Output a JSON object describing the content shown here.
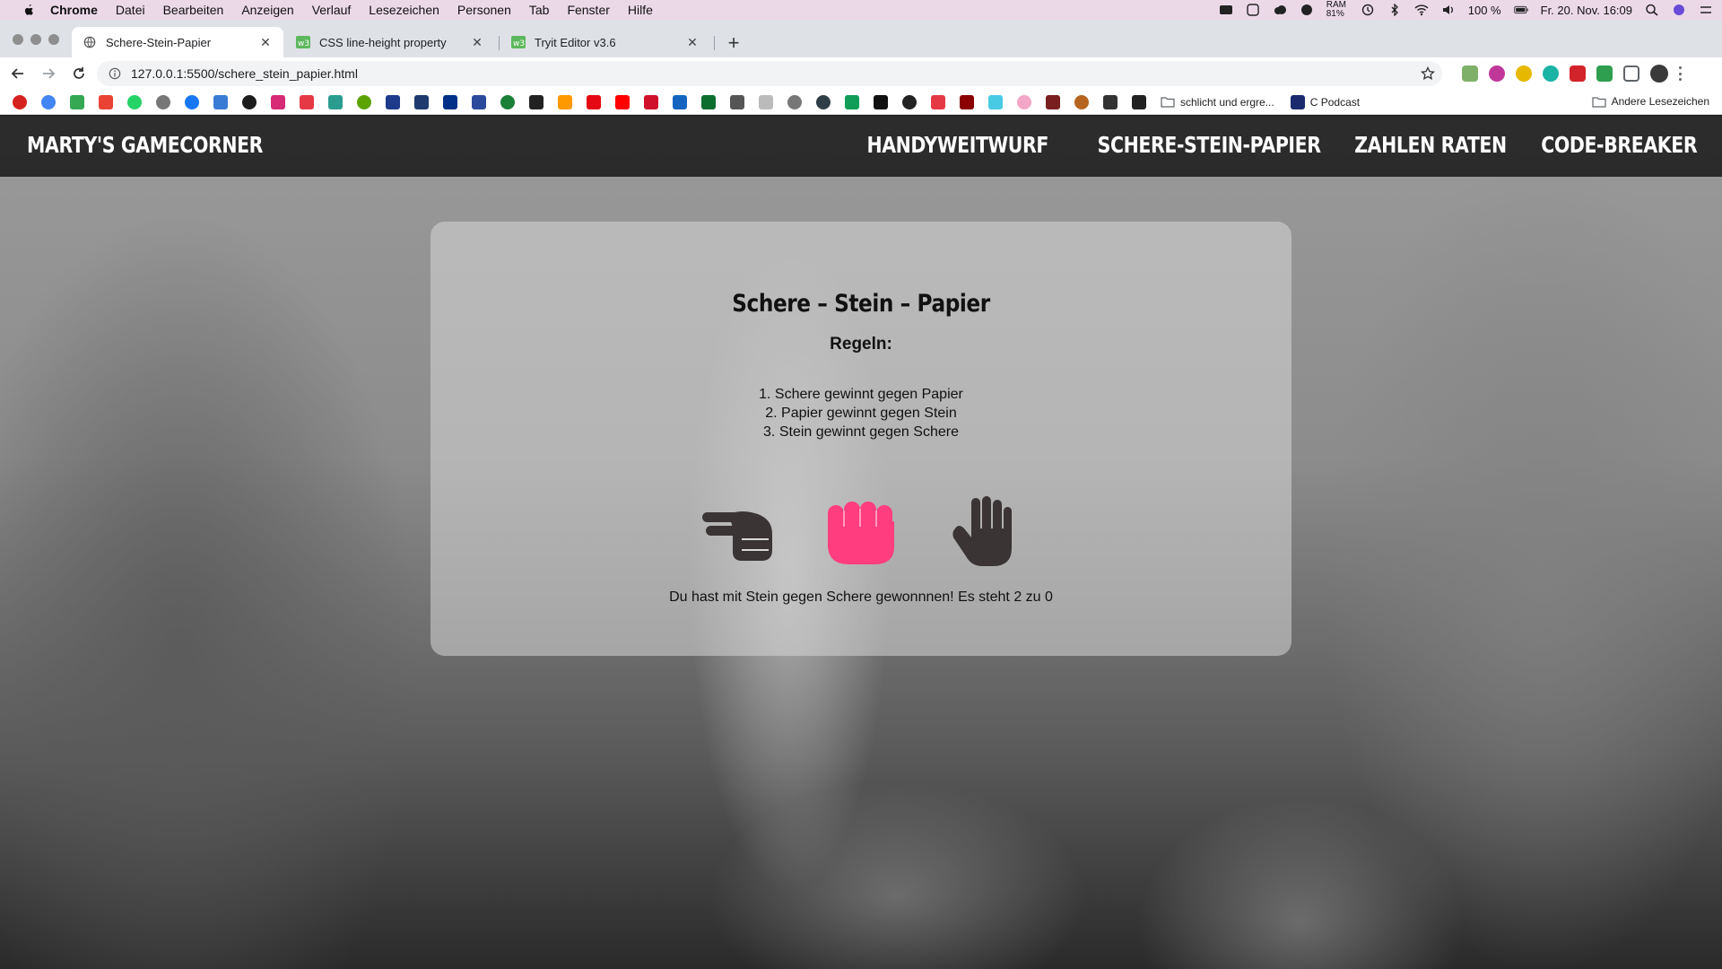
{
  "menubar": {
    "app": "Chrome",
    "items": [
      "Datei",
      "Bearbeiten",
      "Anzeigen",
      "Verlauf",
      "Lesezeichen",
      "Personen",
      "Tab",
      "Fenster",
      "Hilfe"
    ],
    "ram": "RAM 81%",
    "battery": "100 %",
    "datetime": "Fr. 20. Nov. 16:09"
  },
  "tabs": [
    {
      "title": "Schere-Stein-Papier",
      "active": true
    },
    {
      "title": "CSS line-height property",
      "active": false
    },
    {
      "title": "Tryit Editor v3.6",
      "active": false
    }
  ],
  "toolbar": {
    "url": "127.0.0.1:5500/schere_stein_papier.html"
  },
  "bookmarks": {
    "folders": [
      "schlicht und ergre...",
      "C Podcast"
    ],
    "other": "Andere Lesezeichen"
  },
  "site": {
    "brand": "MARTY'S GAMECORNER",
    "nav": [
      "HANDYWEITWURF",
      "SCHERE-STEIN-PAPIER",
      "ZAHLEN RATEN",
      "CODE-BREAKER"
    ]
  },
  "game": {
    "title": "Schere – Stein – Papier",
    "rules_heading": "Regeln:",
    "rules": [
      "1. Schere gewinnt gegen Papier",
      "2. Papier gewinnt gegen Stein",
      "3. Stein gewinnt gegen Schere"
    ],
    "choices": [
      "scissors-hand-icon",
      "fist-icon",
      "open-hand-icon"
    ],
    "selected_color": "#ff3d7f",
    "default_color": "#3a3434",
    "result": "Du hast mit Stein gegen Schere gewonnnen! Es steht 2 zu 0"
  }
}
